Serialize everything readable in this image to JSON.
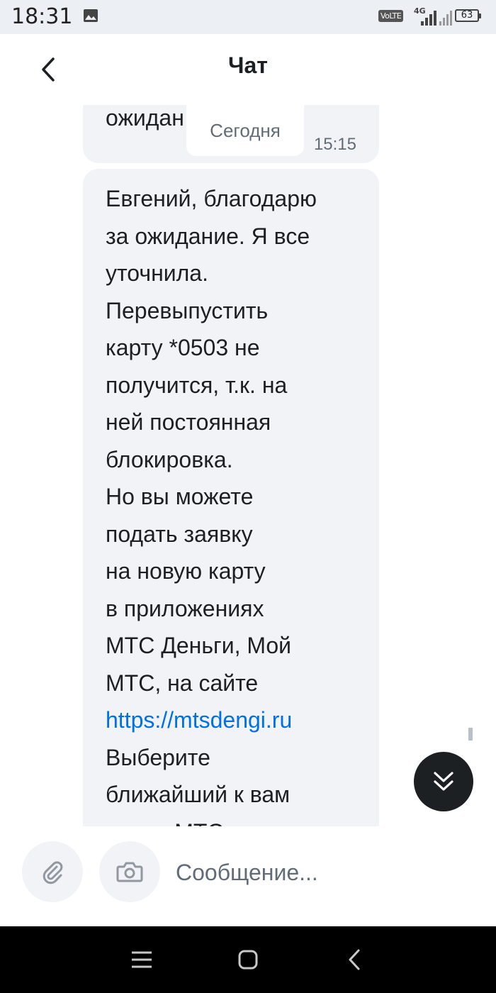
{
  "status_bar": {
    "time": "18:31",
    "network_label": "VoLTE",
    "network_type": "4G",
    "battery_level": "63",
    "icons": [
      "photo-icon",
      "signal-icon",
      "battery-icon"
    ]
  },
  "header": {
    "title": "Чат",
    "back_icon": "chevron-left-icon"
  },
  "chat": {
    "previous_message": {
      "text_fragment": "ожидан",
      "time": "15:15"
    },
    "date_divider": "Сегодня",
    "current_message": {
      "lines": [
        "Евгений, благодарю",
        "за ожидание. Я все",
        "уточнила.",
        "Перевыпустить",
        "карту *0503 не",
        "получится, т.к. на",
        "ней постоянная",
        "блокировка.",
        "Но вы можете",
        "подать заявку",
        "на новую карту",
        "в приложениях",
        "МТС Деньги, Мой",
        "МТС, на сайте"
      ],
      "link": "https://mtsdengi.ru",
      "lines_after_link": [
        "Выберите",
        "ближайший к вам",
        "салон МТС"
      ]
    },
    "scroll_down_icon": "double-chevron-down-icon"
  },
  "input_bar": {
    "attach_icon": "paperclip-icon",
    "camera_icon": "camera-icon",
    "placeholder": "Сообщение..."
  },
  "navigation_bar": {
    "icons": [
      "menu-icon",
      "home-icon",
      "back-icon"
    ]
  },
  "colors": {
    "bubble_background": "#f2f3f7",
    "text_primary": "#1d2023",
    "text_secondary": "#626c77",
    "link": "#0070e5",
    "status_bar_background": "#eceff3",
    "nav_bar_background": "#000000"
  }
}
